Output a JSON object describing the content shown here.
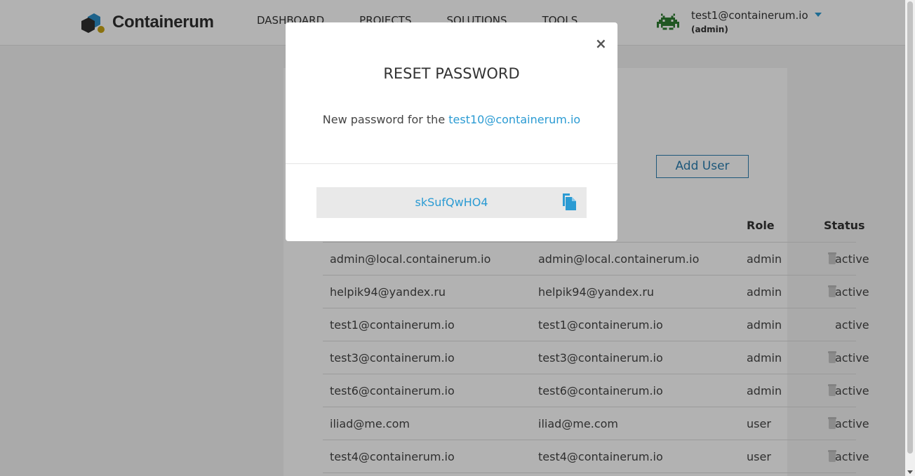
{
  "app": {
    "logo_text": "Containerum"
  },
  "nav": {
    "items": [
      "DASHBOARD",
      "PROJECTS",
      "SOLUTIONS",
      "TOOLS"
    ]
  },
  "user": {
    "email": "test1@containerum.io",
    "role": "(admin)"
  },
  "page": {
    "add_user_label": "Add User"
  },
  "table": {
    "headers": {
      "role": "Role",
      "status": "Status"
    },
    "rows": [
      {
        "login": "admin@local.containerum.io",
        "email": "admin@local.containerum.io",
        "role": "admin",
        "status": "active",
        "deletable": true
      },
      {
        "login": "helpik94@yandex.ru",
        "email": "helpik94@yandex.ru",
        "role": "admin",
        "status": "active",
        "deletable": true
      },
      {
        "login": "test1@containerum.io",
        "email": "test1@containerum.io",
        "role": "admin",
        "status": "active",
        "deletable": false
      },
      {
        "login": "test3@containerum.io",
        "email": "test3@containerum.io",
        "role": "admin",
        "status": "active",
        "deletable": true
      },
      {
        "login": "test6@containerum.io",
        "email": "test6@containerum.io",
        "role": "admin",
        "status": "active",
        "deletable": true
      },
      {
        "login": "iliad@me.com",
        "email": "iliad@me.com",
        "role": "user",
        "status": "active",
        "deletable": true
      },
      {
        "login": "test4@containerum.io",
        "email": "test4@containerum.io",
        "role": "user",
        "status": "active",
        "deletable": true
      }
    ]
  },
  "modal": {
    "close_symbol": "×",
    "title": "RESET PASSWORD",
    "text_prefix": "New password for the ",
    "target_email": "test10@containerum.io",
    "new_password": "skSufQwHO4"
  },
  "colors": {
    "accent": "#2b9bd3",
    "logo_dark": "#333333",
    "logo_blue": "#2b8fc7",
    "logo_gold": "#c8a415"
  },
  "icons": {
    "copy": "copy-icon",
    "delete": "trash-icon",
    "dropdown": "chevron-down-icon",
    "close": "close-icon"
  }
}
